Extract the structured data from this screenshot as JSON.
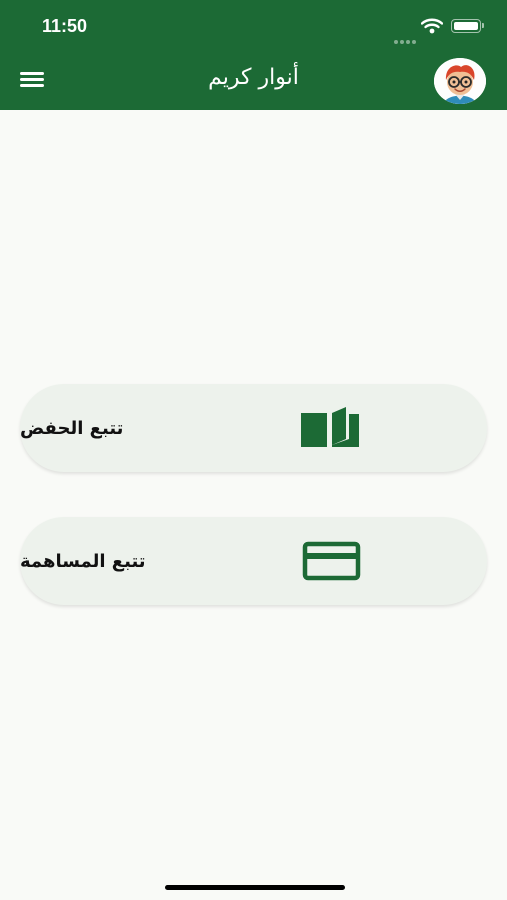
{
  "status_bar": {
    "time": "11:50"
  },
  "header": {
    "title": "أنوار كريم"
  },
  "main": {
    "cards": [
      {
        "label": "تتبع الحفض",
        "icon": "open-book-icon"
      },
      {
        "label": "تتبع المساهمة",
        "icon": "credit-card-icon"
      }
    ]
  },
  "colors": {
    "primary": "#1c6a35",
    "background": "#f9faf7",
    "card_background": "#edf2ec"
  }
}
